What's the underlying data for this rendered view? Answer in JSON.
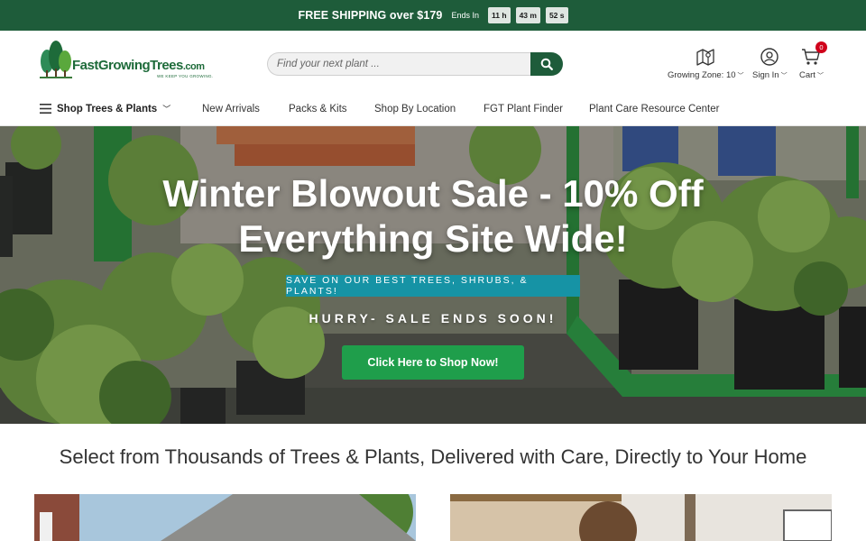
{
  "promo": {
    "text": "FREE SHIPPING over $179",
    "ends_label": "Ends In",
    "hours": "11 h",
    "minutes": "43 m",
    "seconds": "52 s"
  },
  "header": {
    "logo_text": "FastGrowingTrees",
    "logo_suffix": ".com",
    "logo_tagline": "WE KEEP YOU GROWING.",
    "search_placeholder": "Find your next plant ...",
    "zone_label": "Growing Zone: 10",
    "signin_label": "Sign In",
    "cart_label": "Cart",
    "cart_count": "0"
  },
  "nav": {
    "shop_label": "Shop Trees & Plants",
    "items": [
      "New Arrivals",
      "Packs & Kits",
      "Shop By Location",
      "FGT Plant Finder",
      "Plant Care Resource Center"
    ]
  },
  "hero": {
    "headline_1": "Winter Blowout Sale - 10% Off",
    "headline_2": "Everything Site Wide!",
    "subbanner": "SAVE ON OUR BEST TREES, SHRUBS, & PLANTS!",
    "hurry": "HURRY- SALE ENDS SOON!",
    "cta": "Click Here to Shop Now!"
  },
  "tagline": "Select from Thousands of Trees & Plants, Delivered with Care, Directly to Your Home",
  "colors": {
    "brand_green": "#1e5c3a",
    "cta_green": "#1f9e4b",
    "teal_banner": "#1693a5",
    "badge_red": "#d0021b"
  }
}
